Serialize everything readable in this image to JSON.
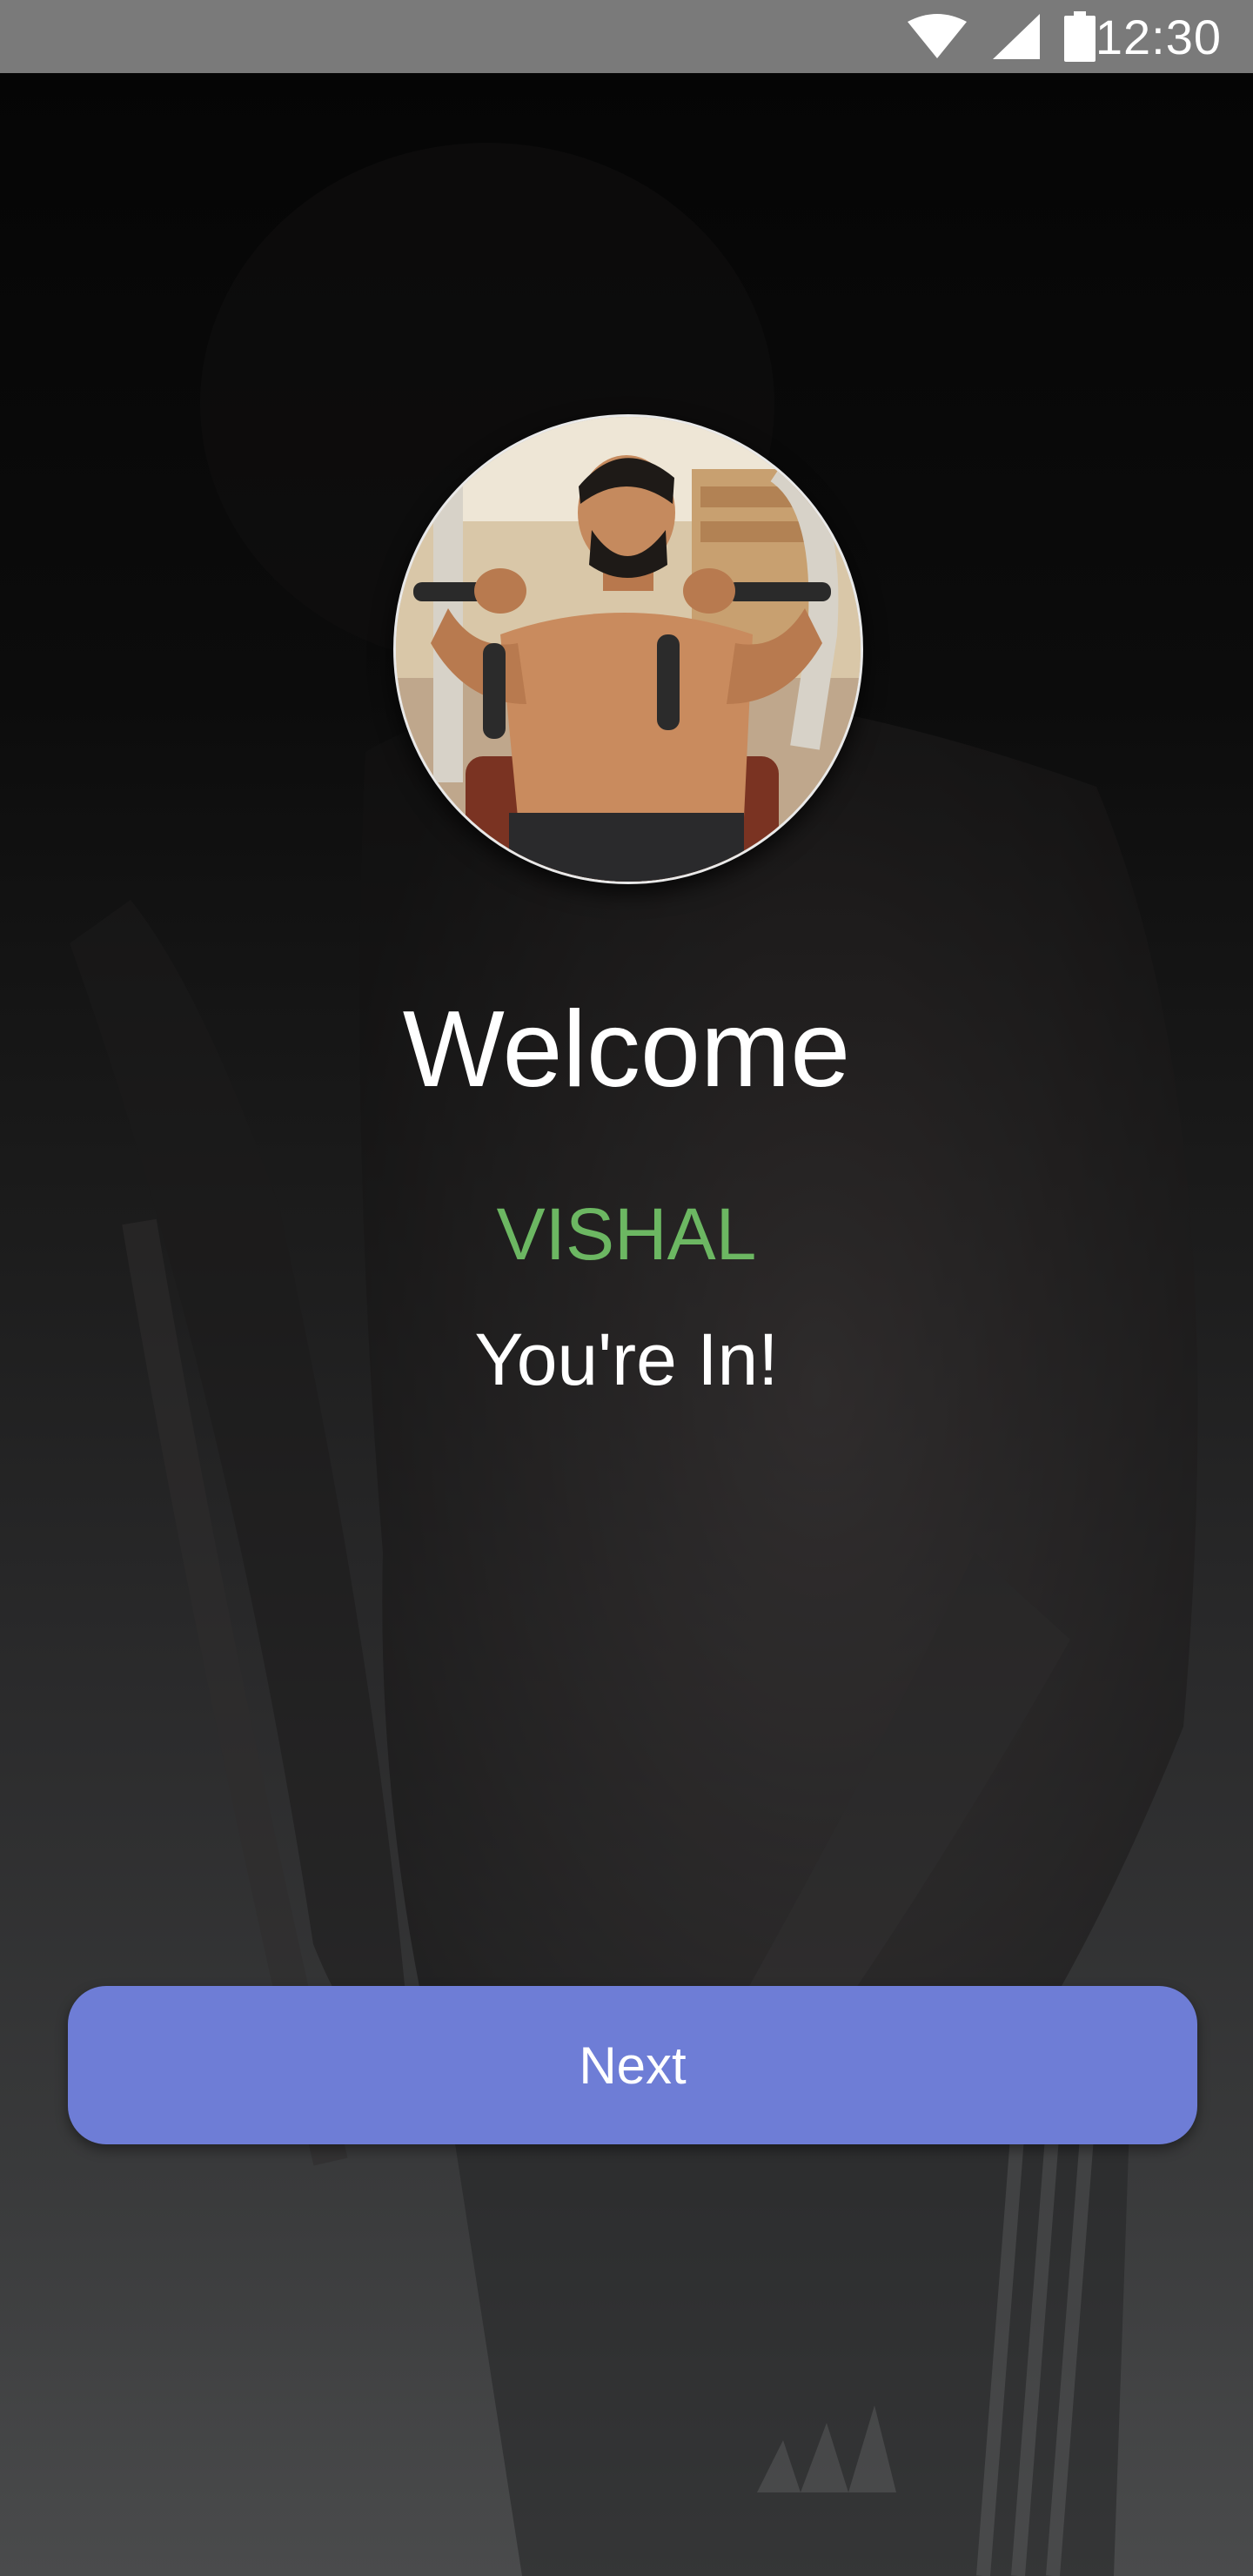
{
  "status_bar": {
    "time": "12:30",
    "icons": [
      "wifi-icon",
      "cellular-signal-icon",
      "battery-icon"
    ]
  },
  "main": {
    "background_image": "gym-athlete-background",
    "avatar_image": "athlete-on-chest-press-machine",
    "welcome_text": "Welcome",
    "user_name": "VISHAL",
    "subtitle": "You're In!",
    "next_label": "Next"
  },
  "colors": {
    "accent": "#6e7dd6",
    "name_green": "#6cb762",
    "text": "#ffffff",
    "status_bar": "#7a7a7a"
  }
}
